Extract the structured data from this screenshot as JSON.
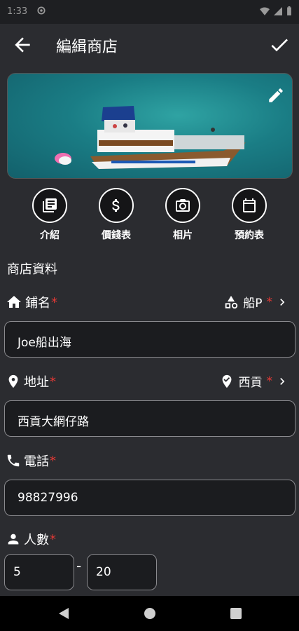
{
  "status": {
    "time": "1:33"
  },
  "appbar": {
    "title": "編緝商店"
  },
  "actions": [
    {
      "label": "介紹",
      "icon": "library-icon"
    },
    {
      "label": "價錢表",
      "icon": "dollar-icon"
    },
    {
      "label": "相片",
      "icon": "camera-icon"
    },
    {
      "label": "預約表",
      "icon": "calendar-icon"
    }
  ],
  "section_title": "商店資料",
  "shop_name": {
    "label": "鋪名",
    "required": "*",
    "category": "船P",
    "value": "Joe船出海"
  },
  "address": {
    "label": "地址",
    "required": "*",
    "district": "西貢",
    "value": "西貢大網仔路"
  },
  "phone": {
    "label": "電話",
    "required": "*",
    "value": "98827996"
  },
  "people": {
    "label": "人數",
    "required": "*",
    "min": "5",
    "separator": "-",
    "max": "20"
  },
  "colors": {
    "accent_required": "#e53935",
    "background": "#2b2c30"
  }
}
